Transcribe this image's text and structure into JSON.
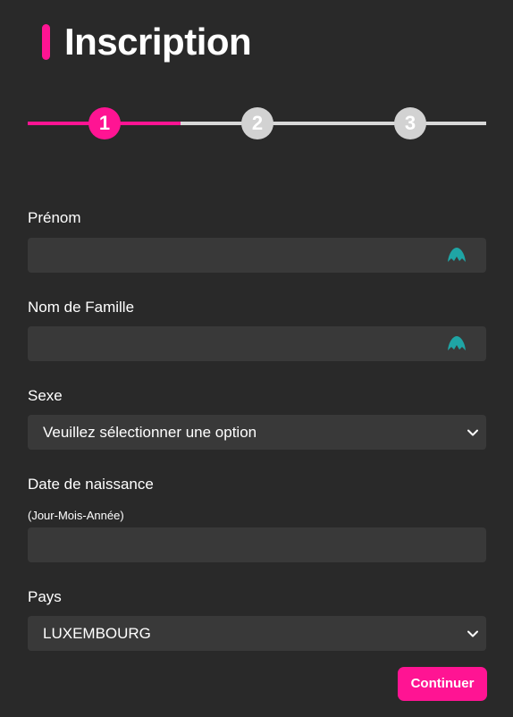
{
  "header": {
    "title": "Inscription"
  },
  "stepper": {
    "steps": [
      "1",
      "2",
      "3"
    ],
    "current_step": 1,
    "progress": 0.333
  },
  "form": {
    "first_name": {
      "label": "Prénom",
      "value": ""
    },
    "last_name": {
      "label": "Nom de Famille",
      "value": ""
    },
    "sex": {
      "label": "Sexe",
      "selected": "Veuillez sélectionner une option"
    },
    "birth_date": {
      "label": "Date de naissance",
      "hint": "(Jour-Mois-Année)",
      "value": ""
    },
    "country": {
      "label": "Pays",
      "selected": "LUXEMBOURG"
    }
  },
  "actions": {
    "continue_label": "Continuer"
  },
  "colors": {
    "accent": "#ff1493",
    "background": "#292929",
    "field": "#393939",
    "autofill_icon": "#1fa5a5"
  },
  "icons": {
    "field_autofill": "autofill-extension-icon",
    "select": "chevron-down-icon"
  }
}
